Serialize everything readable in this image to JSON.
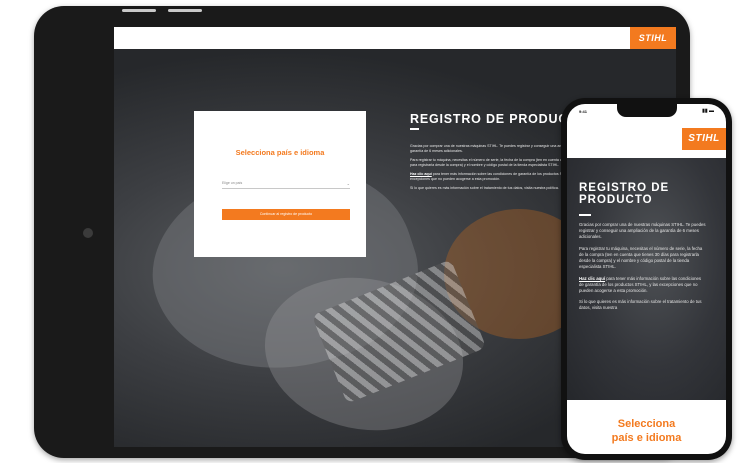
{
  "brand": {
    "logo_text": "STIHL",
    "accent_color": "#f37a1f"
  },
  "tablet": {
    "card": {
      "title": "Selecciona país e idioma",
      "select_placeholder": "Elige un país",
      "button_label": "Continuar al registro de producto"
    },
    "title": "REGISTRO DE PRODUCTO",
    "paragraphs": [
      "Gracias por comprar una de nuestras máquinas STIHL. Te puedes registrar y conseguir una ampliación de la garantía de 6 meses adicionales.",
      "Para registrar tu máquina, necesitas el número de serie, la fecha de la compra (ten en cuenta que tienes 30 días para registrarla desde la compra) y el nombre y código postal de la tienda especialista STIHL.",
      "Haz clic aquí para tener más información sobre las condiciones de garantía de los productos STIHL, y las excepciones que no pueden acogerse a esta promoción.",
      "Si lo que quieres es más información sobre el tratamiento de tus datos, visita nuestra política."
    ],
    "link_text": "Haz clic aquí"
  },
  "phone": {
    "status_time": "9:41",
    "title_line1": "REGISTRO DE",
    "title_line2": "PRODUCTO",
    "paragraphs": [
      "Gracias por comprar una de nuestras máquinas STIHL. Te puedes registrar y conseguir una ampliación de la garantía de 6 meses adicionales.",
      "Para registrar tu máquina, necesitas el número de serie, la fecha de la compra (ten en cuenta que tienes 30 días para registrarla desde la compra) y el nombre y código postal de la tienda especialista STIHL.",
      "Haz clic aquí para tener más información sobre las condiciones de garantía de los productos STIHL, y las excepciones que no pueden acogerse a esta promoción.",
      "Si lo que quieres es más información sobre el tratamiento de tus datos, visita nuestra"
    ],
    "card_title_line1": "Selecciona",
    "card_title_line2": "país e idioma"
  }
}
